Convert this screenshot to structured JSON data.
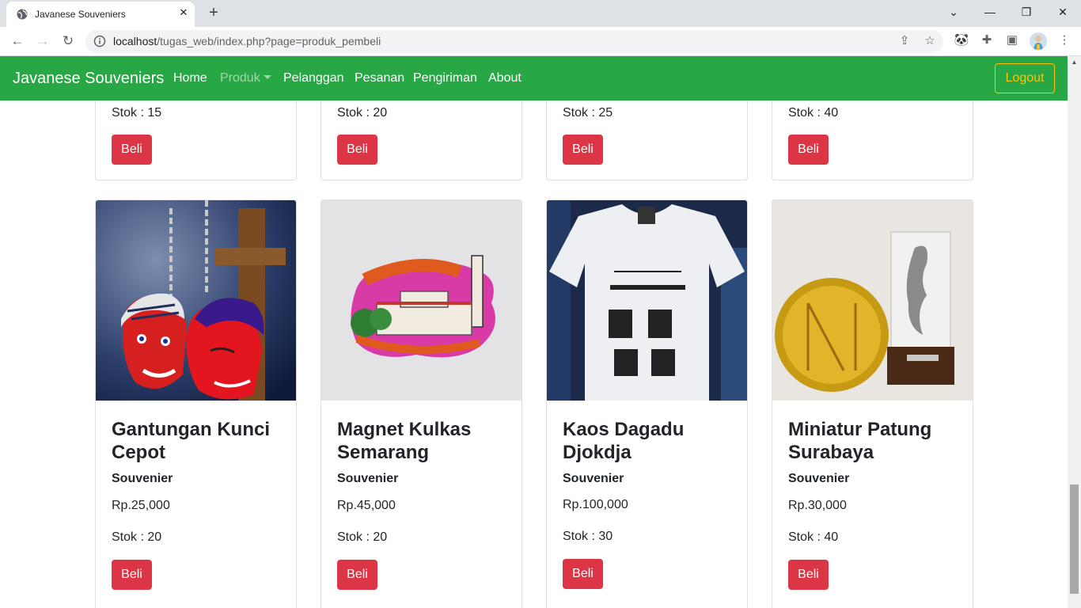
{
  "browser": {
    "tab_title": "Javanese Souveniers",
    "url_host": "localhost",
    "url_path": "/tugas_web/index.php?page=produk_pembeli"
  },
  "navbar": {
    "brand": "Javanese Souveniers",
    "links": [
      "Home",
      "Produk",
      "Pelanggan",
      "Pesanan",
      "Pengiriman",
      "About"
    ],
    "logout": "Logout",
    "colors": {
      "navbar": "#28a745",
      "logout": "#ffc107",
      "buy_button": "#dc3545"
    }
  },
  "top_row": [
    {
      "stock": "Stok : 15",
      "buy": "Beli"
    },
    {
      "stock": "Stok : 20",
      "buy": "Beli"
    },
    {
      "stock": "Stok : 25",
      "buy": "Beli"
    },
    {
      "stock": "Stok : 40",
      "buy": "Beli"
    }
  ],
  "products": [
    {
      "title": "Gantungan Kunci Cepot",
      "category": "Souvenier",
      "price": "Rp.25,000",
      "stock": "Stok : 20",
      "buy": "Beli"
    },
    {
      "title": "Magnet Kulkas Semarang",
      "category": "Souvenier",
      "price": "Rp.45,000",
      "stock": "Stok : 20",
      "buy": "Beli"
    },
    {
      "title": "Kaos Dagadu Djokdja",
      "category": "Souvenier",
      "price": "Rp.100,000",
      "stock": "Stok : 30",
      "buy": "Beli"
    },
    {
      "title": "Miniatur Patung Surabaya",
      "category": "Souvenier",
      "price": "Rp.30,000",
      "stock": "Stok : 40",
      "buy": "Beli"
    }
  ]
}
